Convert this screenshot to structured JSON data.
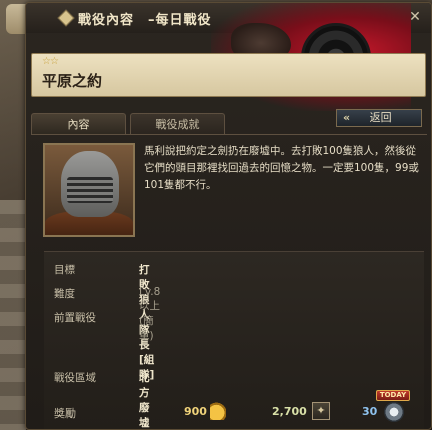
{
  "window": {
    "title": "戰役內容　–每日戰役",
    "close_glyph": "✕"
  },
  "quest": {
    "stars": "☆☆",
    "name": "平原之約"
  },
  "tabs": [
    {
      "label": "內容"
    },
    {
      "label": "戰役成就"
    }
  ],
  "back_button": {
    "arrows": "«",
    "label": "返回"
  },
  "description": "馬利說把約定之劍扔在廢墟中。去打敗100隻狼人，然後從它們的頭目那裡找回過去的回憶之物。一定要100隻，99或101隻都不行。",
  "info": {
    "target_label": "目標",
    "target_value": "打敗狼人隊長[組隊]",
    "difficulty_label": "難度",
    "difficulty_value": "Lv.8 以上 (簡單)",
    "prereq_label": "前置戰役",
    "prereq_value": "",
    "area_label": "戰役區域",
    "area_value": "北方廢墟",
    "reward_label": "獎勵"
  },
  "rewards": {
    "gold": "900",
    "xp": "2,700",
    "ap": "30",
    "today_badge": "TODAY"
  },
  "colors": {
    "title": "#f1e6c8",
    "banner": "#ede1c0",
    "gold": "#f0d37a",
    "ap": "#8fc3ef"
  }
}
